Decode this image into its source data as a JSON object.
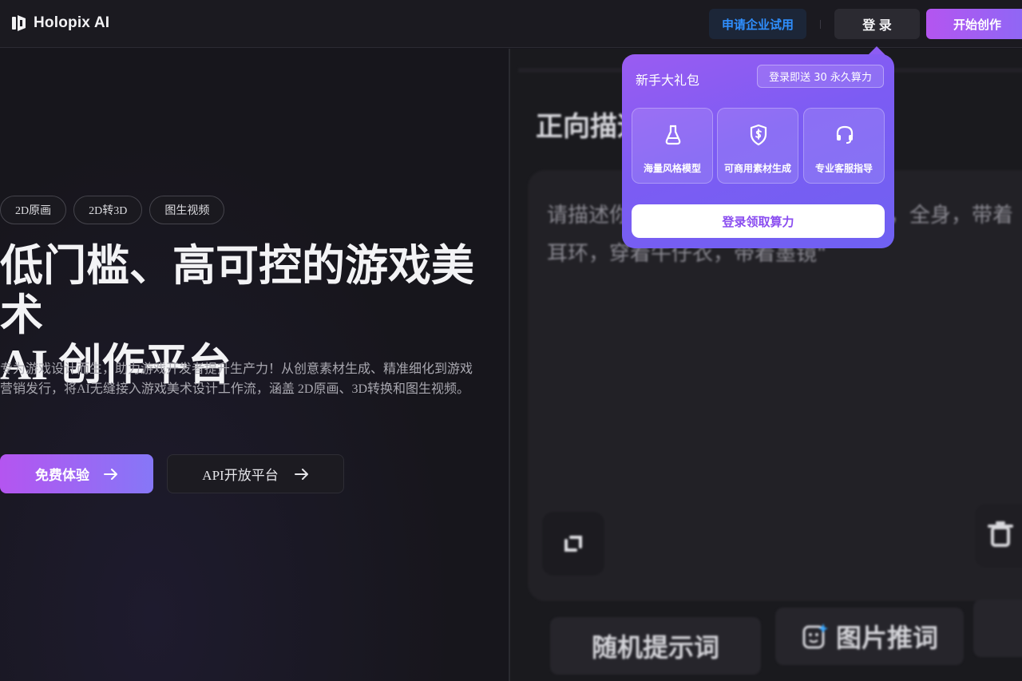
{
  "header": {
    "logo_text": "Holopix AI",
    "enterprise_label": "申请企业试用",
    "login_label": "登 录",
    "start_label": "开始创作"
  },
  "hero": {
    "tags": [
      "2D原画",
      "2D转3D",
      "图生视频"
    ],
    "title_line1": "低门槛、高可控的游戏美术",
    "title_line2": "AI 创作平台",
    "description": "专为游戏设计而生，助力游戏开发者提升生产力！从创意素材生成、精准细化到游戏营销发行，将AI无缝接入游戏美术设计工作流，涵盖 2D原画、3D转换和图生视频。",
    "primary_button": "免费体验",
    "secondary_button": "API开放平台"
  },
  "popover": {
    "title": "新手大礼包",
    "badge": "登录即送 30 永久算力",
    "cards": [
      {
        "label": "海量风格模型",
        "icon": "flask-icon"
      },
      {
        "label": "可商用素材生成",
        "icon": "shield-dollar-icon"
      },
      {
        "label": "专业客服指导",
        "icon": "headset-icon"
      }
    ],
    "cta": "登录领取算力"
  },
  "preview": {
    "heading": "正向描述",
    "prompt_line1": "请描述你想生成的图片，例如：\"少女，全身，带着",
    "prompt_line2": "耳环，穿着牛仔衣，带着墨镜\"",
    "chip_random": "随机提示词",
    "chip_image": "图片推词"
  },
  "colors": {
    "accent_purple": "#9a5cf2",
    "enterprise_blue": "#2f8fff",
    "background": "#17161c"
  }
}
